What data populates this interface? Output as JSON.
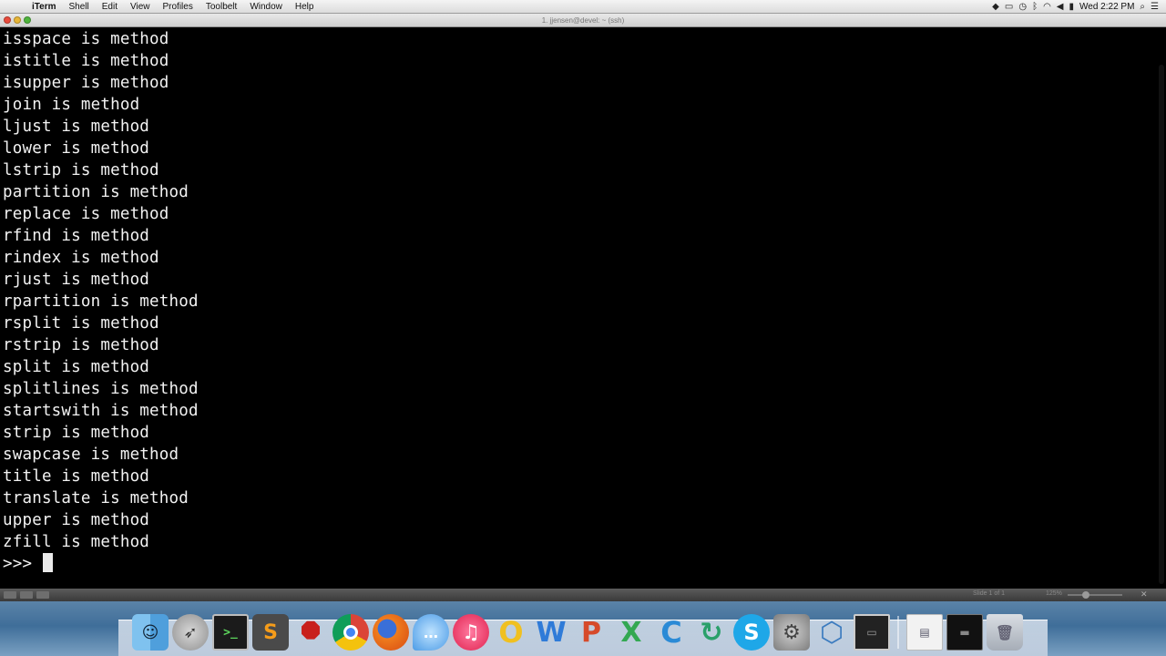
{
  "menubar": {
    "apple_glyph": "",
    "app_name": "iTerm",
    "items": [
      "Shell",
      "Edit",
      "View",
      "Profiles",
      "Toolbelt",
      "Window",
      "Help"
    ],
    "clock": "Wed 2:22 PM"
  },
  "window": {
    "title": "1. jjensen@devel: ~ (ssh)"
  },
  "terminal": {
    "lines": [
      "isspace is method",
      "istitle is method",
      "isupper is method",
      "join is method",
      "ljust is method",
      "lower is method",
      "lstrip is method",
      "partition is method",
      "replace is method",
      "rfind is method",
      "rindex is method",
      "rjust is method",
      "rpartition is method",
      "rsplit is method",
      "rstrip is method",
      "split is method",
      "splitlines is method",
      "startswith is method",
      "strip is method",
      "swapcase is method",
      "title is method",
      "translate is method",
      "upper is method",
      "zfill is method"
    ],
    "prompt": ">>> "
  },
  "statusline": {
    "position": "Slide 1 of 1",
    "zoom": "125%"
  },
  "dock": {
    "apps": [
      {
        "name": "finder",
        "glyph": "☺"
      },
      {
        "name": "launchpad",
        "glyph": "➶"
      },
      {
        "name": "terminal",
        "glyph": ">_"
      },
      {
        "name": "sublime-text",
        "glyph": "S"
      },
      {
        "name": "rubymine",
        "glyph": "⯃"
      },
      {
        "name": "chrome",
        "glyph": ""
      },
      {
        "name": "firefox",
        "glyph": ""
      },
      {
        "name": "messages",
        "glyph": "…"
      },
      {
        "name": "itunes",
        "glyph": "♫"
      },
      {
        "name": "opera",
        "glyph": "O"
      },
      {
        "name": "word",
        "glyph": "W"
      },
      {
        "name": "powerpoint",
        "glyph": "P"
      },
      {
        "name": "excel",
        "glyph": "X"
      },
      {
        "name": "c-app",
        "glyph": "C"
      },
      {
        "name": "sync",
        "glyph": "↻"
      },
      {
        "name": "skype",
        "glyph": "S"
      },
      {
        "name": "system-preferences",
        "glyph": "⚙"
      },
      {
        "name": "virtualbox",
        "glyph": "⬡"
      },
      {
        "name": "screen-capture",
        "glyph": "▭"
      }
    ],
    "stacks": [
      {
        "name": "documents-stack",
        "glyph": "▤"
      },
      {
        "name": "screen-stack",
        "glyph": "▬"
      },
      {
        "name": "trash",
        "glyph": "🗑"
      }
    ]
  },
  "colors": {
    "terminal_bg": "#000000",
    "terminal_fg": "#f2f2f2",
    "menubar_bg": "#e6e6e6"
  }
}
